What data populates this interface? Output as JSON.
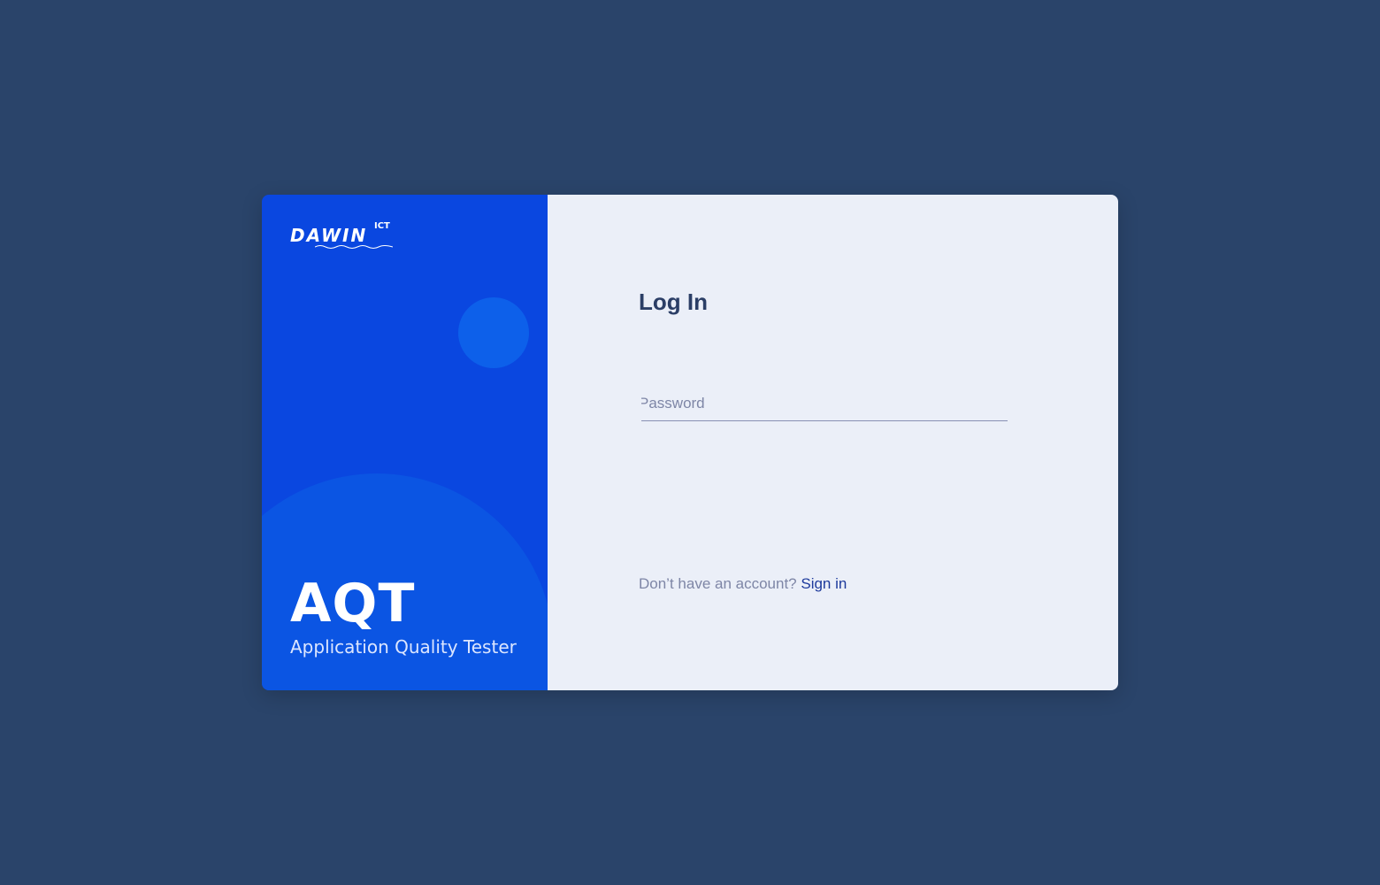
{
  "brand": {
    "logo_text": "DAWIN",
    "logo_superscript": "ICT",
    "product_name": "AQT",
    "product_tagline": "Application Quality Tester"
  },
  "login": {
    "title": "Log In",
    "password_placeholder": "Password",
    "no_account_text": "Don’t have an account?",
    "sign_in_link": "Sign in"
  },
  "colors": {
    "background": "#2a446a",
    "brand_panel": "#0a47e0",
    "form_panel": "#ebeff8",
    "title_text": "#2b3e66",
    "link": "#1d3a9c"
  }
}
